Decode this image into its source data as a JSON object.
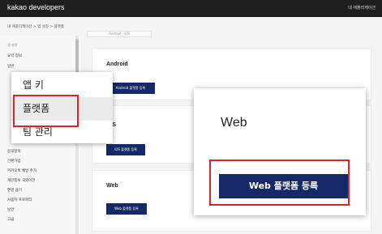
{
  "header": {
    "brand": "kakao developers",
    "user": "내 애플리케이션"
  },
  "breadcrumb": "내 애플리케이션 > 앱 설정 > 플랫폼",
  "sidebar": {
    "section": "앱 설정",
    "items": [
      "요약 정보",
      "일반",
      "",
      "",
      "",
      "",
      "",
      "",
      "",
      "",
      "",
      "",
      "",
      "동의항목",
      "간편가입",
      "카카오톡 채널 추가",
      "개인정보 국외이전",
      "연결 끊기",
      "사용자 프로퍼티",
      "보안",
      "고급"
    ]
  },
  "main": {
    "tabs": "Android · iOS",
    "sections": [
      {
        "title": "Android",
        "button": "Android 플랫폼 등록"
      },
      {
        "title": "iOS",
        "button": "iOS 플랫폼 등록"
      },
      {
        "title": "Web",
        "button": "Web 플랫폼 등록"
      }
    ]
  },
  "popup": {
    "items": [
      "앱 키",
      "플랫폼",
      "팀 관리"
    ],
    "selected_index": 1
  },
  "zoom": {
    "title": "Web",
    "button": "Web 플랫폼 등록"
  },
  "colors": {
    "button": "#152967",
    "highlight": "#d9262b",
    "topbar": "#1e1e1e"
  }
}
